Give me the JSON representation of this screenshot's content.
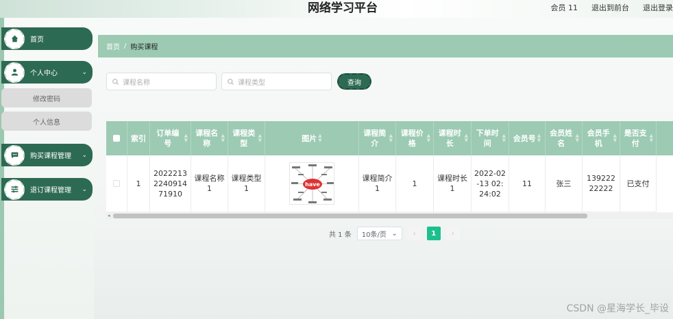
{
  "header": {
    "title": "网络学习平台",
    "links": [
      "会员 11",
      "退出到前台",
      "退出登录"
    ]
  },
  "sidebar": {
    "items": [
      {
        "label": "首页",
        "icon": "home-icon"
      },
      {
        "label": "个人中心",
        "icon": "user-icon",
        "expanded": true
      },
      {
        "label": "购买课程管理",
        "icon": "chat-icon"
      },
      {
        "label": "退订课程管理",
        "icon": "sliders-icon"
      }
    ],
    "sub_items": [
      "修改密码",
      "个人信息"
    ]
  },
  "breadcrumb": {
    "home": "首页",
    "separator": "/",
    "current": "购买课程"
  },
  "search": {
    "course_name_placeholder": "课程名称",
    "course_type_placeholder": "课程类型",
    "query_label": "查询"
  },
  "table": {
    "headers": [
      "索引",
      "订单编号",
      "课程名称",
      "课程类型",
      "图片",
      "课程简介",
      "课程价格",
      "课程时长",
      "下单时间",
      "会员号",
      "会员姓名",
      "会员手机",
      "是否支付"
    ],
    "rows": [
      {
        "index": "1",
        "order_no": "2022213224091471910",
        "course_name": "课程名称1",
        "course_type": "课程类型1",
        "image_text": "have",
        "intro": "课程简介1",
        "price": "1",
        "duration": "课程时长1",
        "order_time": "2022-02-13 02:24:02",
        "member_no": "11",
        "member_name": "张三",
        "member_phone": "13922222222",
        "paid": "已支付"
      }
    ]
  },
  "pagination": {
    "total": "共 1 条",
    "page_size": "10条/页",
    "current_page": "1",
    "prev": "‹",
    "next": "›"
  },
  "watermark": "CSDN @星海学长_毕设",
  "colors": {
    "primary": "#2d6a53",
    "header_bg": "#9ccab3",
    "active_page": "#1dbf8e"
  }
}
